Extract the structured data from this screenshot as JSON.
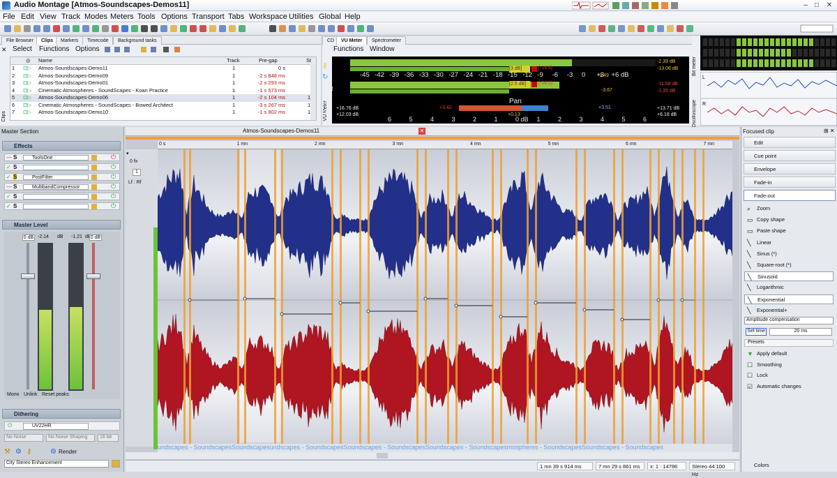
{
  "window": {
    "title": "Audio Montage [Atmos-Soundscapes-Demos11]"
  },
  "menu": [
    "File",
    "Edit",
    "View",
    "Track",
    "Modes",
    "Meters",
    "Tools",
    "Options",
    "Transport",
    "Tabs",
    "Workspace",
    "Utilities",
    "Global",
    "Help"
  ],
  "clips_panel": {
    "tabs": [
      "File Browser",
      "Clips",
      "Markers",
      "Timecode",
      "Background tasks"
    ],
    "active_tab": "Clips",
    "submenu": [
      "Select",
      "Functions",
      "Options"
    ],
    "side_label": "Clips",
    "columns": [
      "Name",
      "Track",
      "Pre-gap",
      "St"
    ],
    "rows": [
      {
        "n": "1",
        "name": "Atmos-Soundscapes-Demo11",
        "track": "1",
        "pregap": "0 s",
        "st": ""
      },
      {
        "n": "2",
        "name": "Atmos-Soundscapes-Demo09",
        "track": "1",
        "pregap": "-2 s 848 ms",
        "st": ""
      },
      {
        "n": "3",
        "name": "Atmos-Soundscapes-Demo01",
        "track": "1",
        "pregap": "-2 s 293 ms",
        "st": ""
      },
      {
        "n": "4",
        "name": "Cinematic Atmospheres - SoundScapes - Koan Practice",
        "track": "1",
        "pregap": "-1 s 573 ms",
        "st": ""
      },
      {
        "n": "5",
        "name": "Atmos-Soundscapes-Demo06",
        "track": "1",
        "pregap": "-2 s 104 ms",
        "st": "1 n"
      },
      {
        "n": "6",
        "name": "Cinematic Atmospheres - SoundScapes - Bowed Architect",
        "track": "1",
        "pregap": "-3 s 267 ms",
        "st": "1 ms"
      },
      {
        "n": "7",
        "name": "Atmos-Soundscapes-Demo10",
        "track": "1",
        "pregap": "-1 s 902 ms",
        "st": "1 ms"
      }
    ]
  },
  "meter_panel": {
    "tabs": [
      "CD",
      "VU Meter",
      "Spectrometer"
    ],
    "active_tab": "VU Meter",
    "submenu": [
      "Functions",
      "Window"
    ],
    "side_label": "VU Meter",
    "channel_labels": [
      "L",
      "R"
    ],
    "scale": [
      "-45",
      "-42",
      "-39",
      "-36",
      "-33",
      "-30",
      "-27",
      "-24",
      "-21",
      "-18",
      "-15",
      "-12",
      "-9",
      "-6",
      "-3",
      "0",
      "+3",
      "+6 dB"
    ],
    "left_peak_box": "[3 dB]",
    "left_peak_red": "[-14.6]",
    "right_peak_box": "[2.5 dB]",
    "right_peak_red": "[-14.5]",
    "left_readouts": [
      "-2.39 dB",
      "-13.06 dB"
    ],
    "right_readouts": [
      "-11.58 dB",
      "-1.39 dB"
    ],
    "marker_left": "-3.49",
    "marker_right": "-3.67",
    "pan_label": "Pan",
    "pan_left_values": [
      "+16.76 dB",
      "+12.03 dB"
    ],
    "pan_mid_left": "+3.42",
    "pan_center": "+0.13",
    "pan_mid_right": "+3.51",
    "pan_right_values": [
      "+13.71 dB",
      "+6.18 dB"
    ],
    "pan_scale": [
      "6",
      "5",
      "4",
      "3",
      "2",
      "1",
      "0 dB",
      "1",
      "2",
      "3",
      "4",
      "5",
      "6"
    ],
    "row_numbers": [
      "1",
      "2",
      "3"
    ]
  },
  "bit_meter": {
    "label": "Bit meter",
    "side_label_2": "Oscilloscope"
  },
  "master_section": {
    "title": "Master Section",
    "effects_title": "Effects",
    "effects": [
      "ToolsOne",
      "",
      "PostFilter",
      "MultibandCompressor",
      "",
      ""
    ],
    "master_level_title": "Master Level",
    "level_values": [
      "0 dB",
      "-2.14",
      "dB",
      "-1.21",
      "dB",
      "0 dB"
    ],
    "footer_buttons": [
      "Mono",
      "Unlink",
      "Reset peaks"
    ],
    "dithering_title": "Dithering",
    "dither_plugin": "UV22HR",
    "noise_options": [
      "No Noise",
      "No Noise Shaping",
      "16 bit"
    ],
    "render_label": "Render",
    "preset": "City Stereo Enhancement"
  },
  "montage": {
    "tab_title": "Atmos-Soundscapes-Demos11",
    "ruler": [
      "0 s",
      "1 mn",
      "2 mn",
      "3 mn",
      "4 mn",
      "5 mn",
      "6 mn",
      "7 mn"
    ],
    "track_label": "Lf : Rf",
    "track_zero": "0 fx",
    "track_number": "1",
    "clip_names_strip": "undscapes - SoundscapesSoundscapesundscapes - SoundscapesSoundscapes - SoundscapesSoundscapes - Soundscapesmospheres - SoundscapesSoundscapes - Soundscapes"
  },
  "focused_clip": {
    "title": "Focused clip",
    "buttons": [
      "Edit",
      "Cue point",
      "Envelope",
      "Fade-in",
      "Fade-out"
    ],
    "active_button": "Fade-out",
    "items": [
      "Zoom",
      "Copy shape",
      "Paste shape",
      "Linear",
      "Sinus (*)",
      "Square-root (*)",
      "Sinusoid",
      "Logarithmic",
      "Exponential",
      "Exponential+"
    ],
    "selected_items": [
      "Sinusoid",
      "Exponential"
    ],
    "amplitude_label": "Amplitude compensation",
    "set_time_label": "Set time",
    "set_time_value": "20 ms",
    "presets_label": "Presets",
    "options": [
      "Apply default",
      "Smoothing",
      "Lock",
      "Automatic changes"
    ],
    "footer": "Colors"
  },
  "status": {
    "pos1": "1 mn 39 s 914 ms",
    "pos2": "7 mn 29 s 861 ms",
    "zoom": "x: 1 : 14786",
    "format": "Stereo 44 100 Hz"
  },
  "colors": {
    "wave_top": "#22308a",
    "wave_bottom": "#b01522",
    "fade": "#f0a030",
    "meter_green": "#8cc63f",
    "pan_red": "#d9532c",
    "pan_blue": "#3a84d1"
  }
}
